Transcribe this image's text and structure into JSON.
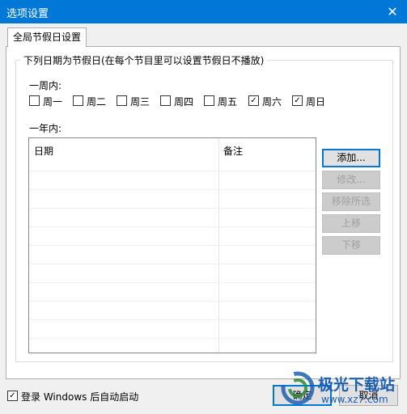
{
  "window": {
    "title": "选项设置",
    "close_glyph": "✕"
  },
  "tab": {
    "label": "全局节假日设置"
  },
  "group": {
    "label": "下列日期为节假日(在每个节目里可以设置节假日不播放)"
  },
  "week": {
    "label": "一周内:",
    "days": [
      {
        "label": "周一",
        "checked": false
      },
      {
        "label": "周二",
        "checked": false
      },
      {
        "label": "周三",
        "checked": false
      },
      {
        "label": "周四",
        "checked": false
      },
      {
        "label": "周五",
        "checked": false
      },
      {
        "label": "周六",
        "checked": true
      },
      {
        "label": "周日",
        "checked": true
      }
    ]
  },
  "year": {
    "label": "一年内:"
  },
  "table": {
    "columns": [
      "日期",
      "备注"
    ],
    "rows": []
  },
  "side_buttons": {
    "add": "添加...",
    "edit": "修改...",
    "remove": "移除所选",
    "up": "上移",
    "down": "下移"
  },
  "autostart": {
    "label": "登录 Windows 后自动启动",
    "checked": true
  },
  "dialog_buttons": {
    "ok": "确定",
    "cancel": "取消"
  },
  "watermark": {
    "text": "极光下载站",
    "url": "www.xz7.com"
  },
  "colors": {
    "titlebar": "#0078d7",
    "accent": "#0078d7",
    "watermark": "#1a5fb4"
  }
}
